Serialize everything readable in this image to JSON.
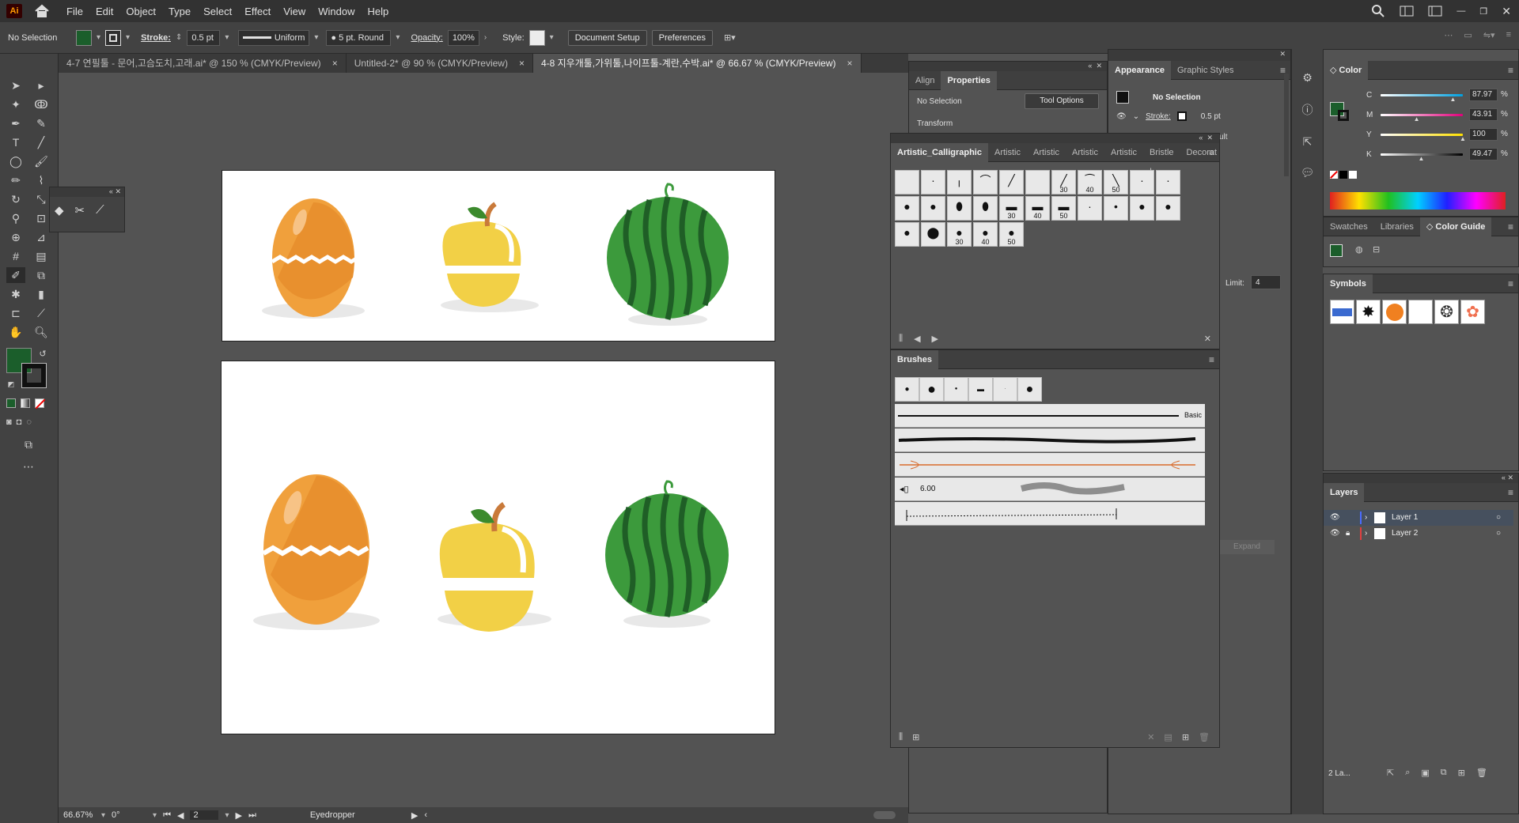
{
  "app": {
    "logo": "Ai",
    "menus": [
      "File",
      "Edit",
      "Object",
      "Type",
      "Select",
      "Effect",
      "View",
      "Window",
      "Help"
    ]
  },
  "control_bar": {
    "selection": "No Selection",
    "fill_color": "#1b5e2b",
    "stroke_label": "Stroke:",
    "stroke_value": "0.5 pt",
    "profile": "Uniform",
    "brush": "5 pt. Round",
    "opacity_label": "Opacity:",
    "opacity_value": "100%",
    "style_label": "Style:",
    "document_setup": "Document Setup",
    "preferences": "Preferences"
  },
  "tabs": [
    {
      "label": "4-7 연필툴 - 문어,고슴도치,고래.ai* @ 150 % (CMYK/Preview)",
      "close": "×"
    },
    {
      "label": "Untitled-2* @ 90 % (CMYK/Preview)",
      "close": "×"
    },
    {
      "label": "4-8 지우개툴,가위툴,나이프툴-계란,수박.ai* @ 66.67 % (CMYK/Preview)",
      "close": "×"
    }
  ],
  "properties_panel": {
    "tabs": [
      "Align",
      "Properties"
    ],
    "no_selection": "No Selection",
    "tool_options": "Tool Options",
    "transform": "Transform",
    "limit_label": "Limit:",
    "limit_value": "4",
    "expand": "Expand"
  },
  "appearance_panel": {
    "tabs": [
      "Appearance",
      "Graphic Styles"
    ],
    "title": "No Selection",
    "stroke_label": "Stroke:",
    "stroke_value": "0.5 pt",
    "partial": "ult"
  },
  "brush_library": {
    "tabs": [
      "Artistic_Calligraphic",
      "Artistic",
      "Artistic",
      "Artistic",
      "Artistic",
      "Bristle I",
      "Decorat"
    ],
    "row1_labels": [
      "",
      "",
      "",
      "",
      "",
      "",
      "30",
      "40",
      "50",
      "",
      ""
    ],
    "row2_labels": [
      "",
      "",
      "",
      "",
      "30",
      "40",
      "50",
      "",
      "",
      "",
      ""
    ],
    "row3_labels": [
      "",
      "",
      "30",
      "40",
      "50"
    ]
  },
  "brushes_panel": {
    "title": "Brushes",
    "basic_label": "Basic",
    "scatter_value": "6.00"
  },
  "color_panel": {
    "title": "Color",
    "channels": [
      {
        "name": "C",
        "value": "87.97",
        "unit": "%",
        "fraction": 0.8797
      },
      {
        "name": "M",
        "value": "43.91",
        "unit": "%",
        "fraction": 0.4391
      },
      {
        "name": "Y",
        "value": "100",
        "unit": "%",
        "fraction": 1.0
      },
      {
        "name": "K",
        "value": "49.47",
        "unit": "%",
        "fraction": 0.4947
      }
    ]
  },
  "swatch_tabs": [
    "Swatches",
    "Libraries",
    "Color Guide"
  ],
  "symbols": {
    "title": "Symbols"
  },
  "layers": {
    "title": "Layers",
    "items": [
      {
        "name": "Layer 1",
        "color": "#4a6cff"
      },
      {
        "name": "Layer 2",
        "color": "#e04040"
      }
    ],
    "count": "2 La..."
  },
  "status": {
    "zoom": "66.67%",
    "rotation": "0°",
    "artboard": "2",
    "tool": "Eyedropper"
  }
}
